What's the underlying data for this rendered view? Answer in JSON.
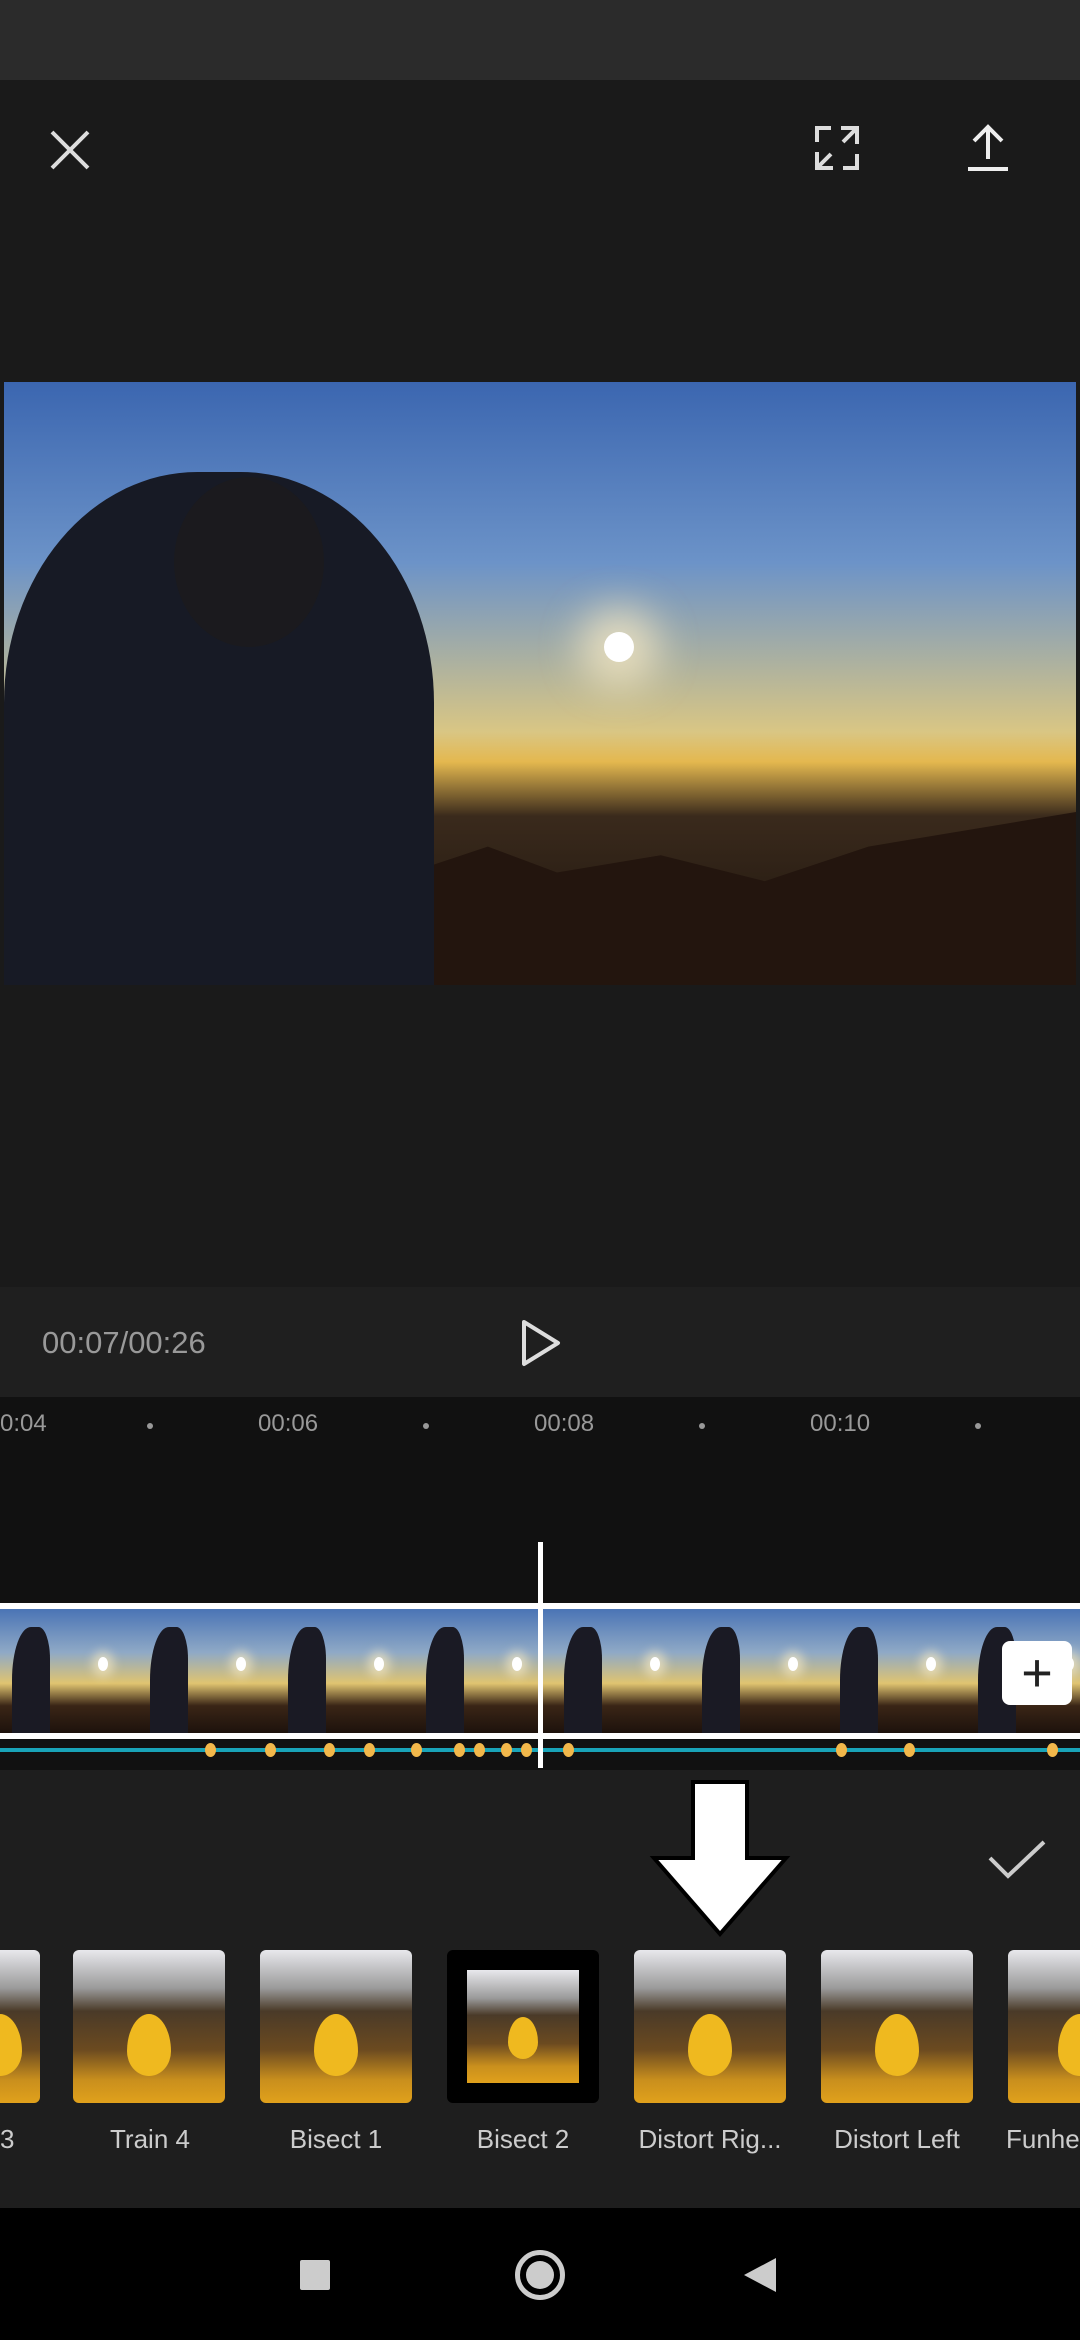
{
  "header": {
    "close_icon": "close-icon",
    "fullscreen_icon": "fullscreen-icon",
    "export_icon": "upload-icon"
  },
  "player": {
    "time": "00:07/00:26",
    "play_icon": "play-icon"
  },
  "timeline": {
    "ticks": [
      "0:04",
      "00:06",
      "00:08",
      "00:10"
    ],
    "add_label": "+",
    "accent": "#19a4b8",
    "keyframe_color": "#f2b84b"
  },
  "transitions": {
    "confirm_icon": "check-icon",
    "selected": "Bisect 2",
    "items": [
      {
        "label": "3"
      },
      {
        "label": "Train 4"
      },
      {
        "label": "Bisect 1"
      },
      {
        "label": "Bisect 2"
      },
      {
        "label": "Distort Rig..."
      },
      {
        "label": "Distort Left"
      },
      {
        "label": "Funhe"
      }
    ]
  },
  "nav": {
    "recents": "square-icon",
    "home": "circle-icon",
    "back": "back-triangle-icon"
  }
}
